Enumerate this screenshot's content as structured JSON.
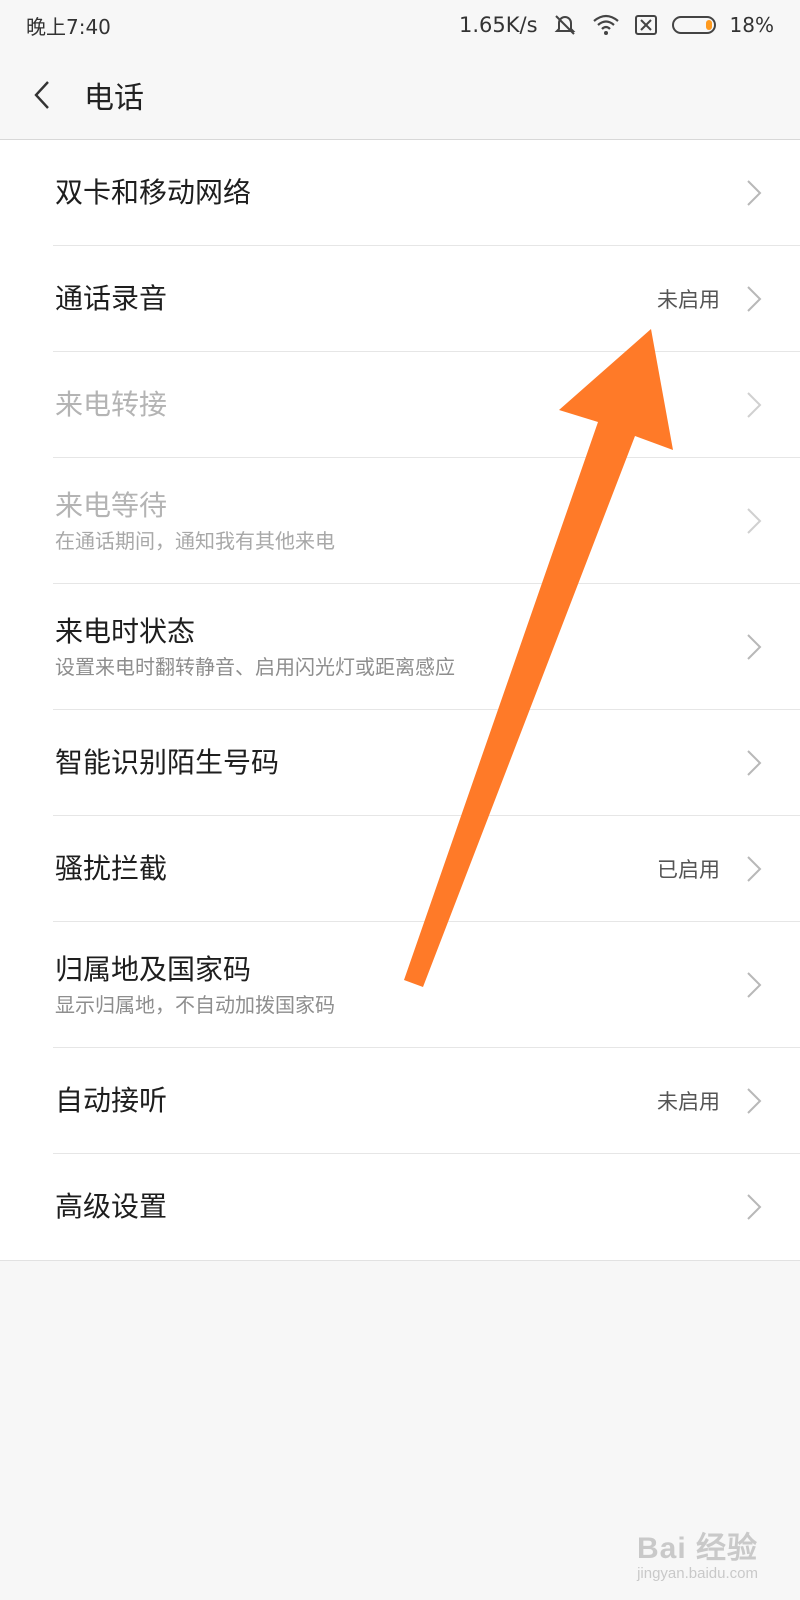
{
  "status_bar": {
    "time": "晚上7:40",
    "network_speed": "1.65K/s",
    "battery_percent": "18%",
    "battery_level": 0.18,
    "icons": [
      "mute-icon",
      "wifi-icon",
      "sim-off-icon",
      "battery-icon"
    ]
  },
  "header": {
    "back_icon": "back-chevron-icon",
    "title": "电话"
  },
  "settings": [
    {
      "title": "双卡和移动网络",
      "subtitle": "",
      "value": "",
      "enabled": true
    },
    {
      "title": "通话录音",
      "subtitle": "",
      "value": "未启用",
      "enabled": true
    },
    {
      "title": "来电转接",
      "subtitle": "",
      "value": "",
      "enabled": false
    },
    {
      "title": "来电等待",
      "subtitle": "在通话期间，通知我有其他来电",
      "value": "",
      "enabled": false
    },
    {
      "title": "来电时状态",
      "subtitle": "设置来电时翻转静音、启用闪光灯或距离感应",
      "value": "",
      "enabled": true
    },
    {
      "title": "智能识别陌生号码",
      "subtitle": "",
      "value": "",
      "enabled": true
    },
    {
      "title": "骚扰拦截",
      "subtitle": "",
      "value": "已启用",
      "enabled": true
    },
    {
      "title": "归属地及国家码",
      "subtitle": "显示归属地，不自动加拨国家码",
      "value": "",
      "enabled": true
    },
    {
      "title": "自动接听",
      "subtitle": "",
      "value": "未启用",
      "enabled": true
    },
    {
      "title": "高级设置",
      "subtitle": "",
      "value": "",
      "enabled": true
    }
  ],
  "annotation": {
    "type": "arrow",
    "color": "#ff7a28",
    "points_to": "通话录音"
  },
  "watermark": {
    "main": "Bai 经验",
    "sub": "jingyan.baidu.com"
  }
}
